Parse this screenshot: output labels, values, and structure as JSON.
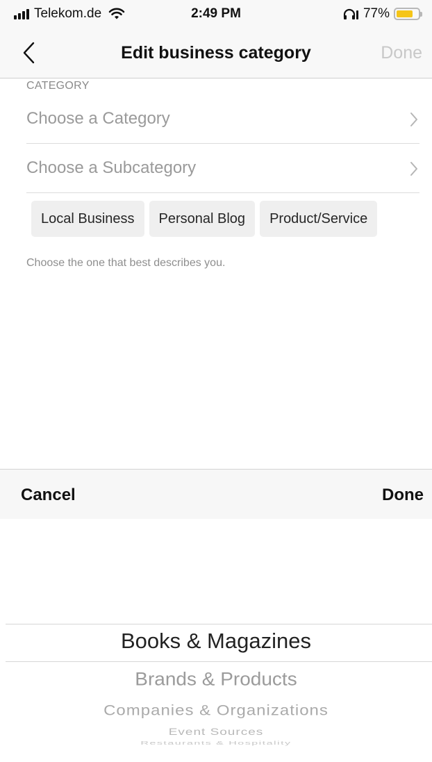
{
  "status_bar": {
    "carrier": "Telekom.de",
    "time": "2:49 PM",
    "battery_percent": "77%",
    "battery_level": 0.77,
    "icons": [
      "signal-icon",
      "wifi-icon",
      "headphones-icon",
      "battery-icon"
    ]
  },
  "nav": {
    "back_icon": "chevron-left-icon",
    "title": "Edit business category",
    "done_label": "Done"
  },
  "form": {
    "section_label": "CATEGORY",
    "category_row": {
      "label": "Choose a Category"
    },
    "subcategory_row": {
      "label": "Choose a Subcategory"
    },
    "chips": [
      "Local Business",
      "Personal Blog",
      "Product/Service"
    ],
    "hint": "Choose the one that best describes you."
  },
  "picker": {
    "cancel_label": "Cancel",
    "done_label": "Done",
    "items": [
      "Books & Magazines",
      "Brands & Products",
      "Companies & Organizations",
      "Event Sources",
      "Restaurants & Hospitality"
    ],
    "selected": "Books & Magazines"
  },
  "colors": {
    "background": "#ffffff",
    "bar_background": "#f8f8f8",
    "disabled_text": "#c8c8c8",
    "chip_background": "#efefef",
    "battery_fill": "#f5c518"
  }
}
